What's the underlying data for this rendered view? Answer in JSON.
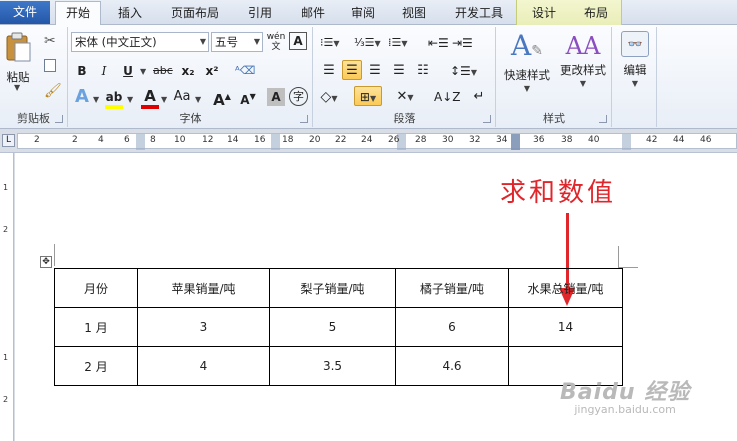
{
  "tabs": [
    {
      "label": "文件"
    },
    {
      "label": "开始"
    },
    {
      "label": "插入"
    },
    {
      "label": "页面布局"
    },
    {
      "label": "引用"
    },
    {
      "label": "邮件"
    },
    {
      "label": "审阅"
    },
    {
      "label": "视图"
    },
    {
      "label": "开发工具"
    },
    {
      "label": "设计"
    },
    {
      "label": "布局"
    }
  ],
  "active_tab": "开始",
  "clipboard": {
    "paste": "粘贴",
    "label": "剪贴板"
  },
  "font": {
    "name": "宋体 (中文正文)",
    "size": "五号",
    "label": "字体",
    "wen": "wén\n文",
    "bold": "B",
    "italic": "I",
    "underline": "U",
    "strike": "abc",
    "sub": "x₂",
    "sup": "x²",
    "grow": "A",
    "shrink": "A",
    "aa": "Aa",
    "A": "A"
  },
  "paragraph": {
    "label": "段落"
  },
  "styles": {
    "quick": "快速样式",
    "change": "更改样式",
    "label": "样式"
  },
  "editing": {
    "label": "编辑"
  },
  "ruler": {
    "top_numbers": [
      "2",
      "2",
      "4",
      "6",
      "8",
      "10",
      "12",
      "14",
      "16",
      "18",
      "20",
      "22",
      "24",
      "26",
      "28",
      "30",
      "32",
      "34",
      "36",
      "38",
      "40",
      "42",
      "44",
      "46"
    ],
    "left_numbers": [
      "1",
      "2",
      "1",
      "2"
    ]
  },
  "annotation": "求和数值",
  "table": {
    "headers": [
      "月份",
      "苹果销量/吨",
      "梨子销量/吨",
      "橘子销量/吨",
      "水果总销量/吨"
    ],
    "rows": [
      [
        "1 月",
        "3",
        "5",
        "6",
        "14"
      ],
      [
        "2 月",
        "4",
        "3.5",
        "4.6",
        ""
      ]
    ]
  },
  "watermark": {
    "logo": "Baidu 经验",
    "url": "jingyan.baidu.com"
  },
  "colors": {
    "annotation": "#e0262b",
    "file_tab": "#2b5fb0",
    "selected": "#fbc955"
  }
}
